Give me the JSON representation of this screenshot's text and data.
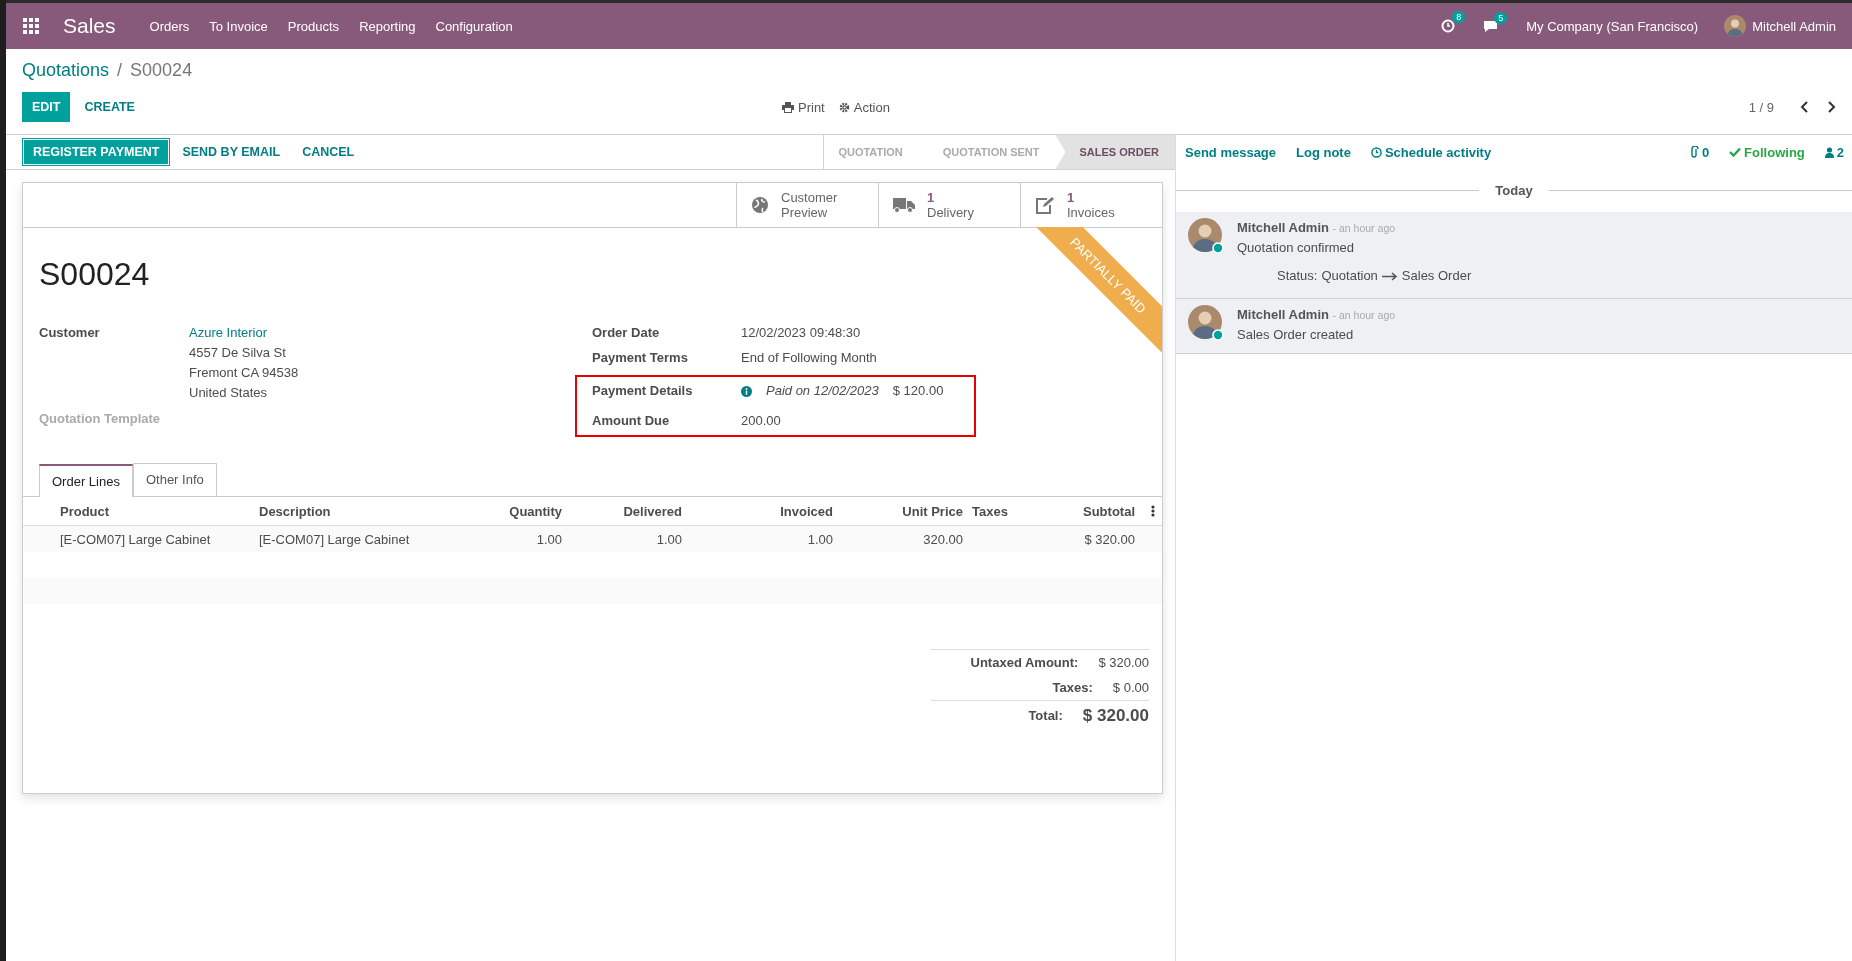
{
  "navbar": {
    "app": "Sales",
    "menu": [
      "Orders",
      "To Invoice",
      "Products",
      "Reporting",
      "Configuration"
    ],
    "activity_count": "8",
    "message_count": "5",
    "company": "My Company (San Francisco)",
    "user": "Mitchell Admin"
  },
  "breadcrumb": {
    "parent": "Quotations",
    "separator": "/",
    "current": "S00024"
  },
  "control_panel": {
    "edit": "EDIT",
    "create": "CREATE",
    "print": "Print",
    "action": "Action",
    "pager": "1 / 9"
  },
  "form_buttons": [
    {
      "label": "REGISTER PAYMENT",
      "primary": true
    },
    {
      "label": "SEND BY EMAIL",
      "primary": false
    },
    {
      "label": "CANCEL",
      "primary": false
    }
  ],
  "stages": [
    {
      "label": "QUOTATION",
      "selected": false
    },
    {
      "label": "QUOTATION SENT",
      "selected": false
    },
    {
      "label": "SALES ORDER",
      "selected": true
    }
  ],
  "smart_buttons": [
    {
      "kind": "globe",
      "label": "Customer Preview"
    },
    {
      "kind": "truck",
      "count": "1",
      "label": "Delivery"
    },
    {
      "kind": "edit",
      "count": "1",
      "label": "Invoices"
    }
  ],
  "ribbon": "PARTIALLY PAID",
  "title": "S00024",
  "customer": {
    "label": "Customer",
    "name": "Azure Interior",
    "address": [
      "4557 De Silva St",
      "Fremont CA 94538",
      "United States"
    ]
  },
  "quotation_template": "Quotation Template",
  "right_fields": [
    {
      "label": "Order Date",
      "value": "12/02/2023 09:48:30"
    },
    {
      "label": "Payment Terms",
      "value": "End of Following Month"
    }
  ],
  "highlighted": {
    "payment_details": {
      "label": "Payment Details",
      "date": "Paid on 12/02/2023",
      "amount": "$ 120.00"
    },
    "amount_due": {
      "label": "Amount Due",
      "value": "200.00"
    }
  },
  "tabs": [
    {
      "label": "Order Lines",
      "selected": true
    },
    {
      "label": "Other Info",
      "selected": false
    }
  ],
  "table": {
    "columns": [
      "Product",
      "Description",
      "Quantity",
      "Delivered",
      "Invoiced",
      "Unit Price",
      "Taxes",
      "Subtotal"
    ],
    "rows": [
      [
        "[E-COM07] Large Cabinet",
        "[E-COM07] Large Cabinet",
        "1.00",
        "1.00",
        "1.00",
        "320.00",
        null,
        "$ 320.00"
      ]
    ]
  },
  "totals": [
    {
      "kind": "line",
      "label": "Untaxed Amount:",
      "value": "$ 320.00"
    },
    {
      "kind": "line",
      "label": "Taxes:",
      "value": "$ 0.00"
    },
    {
      "kind": "total",
      "label": "Total:",
      "value": "$ 320.00"
    }
  ],
  "chatter": {
    "send": "Send message",
    "log": "Log note",
    "schedule": "Schedule activity",
    "attachments": "0",
    "following": "Following",
    "followers": "2",
    "separator": "Today",
    "messages": [
      {
        "author": "Mitchell Admin",
        "time": "- an hour ago",
        "body": "Quotation confirmed",
        "changes": [
          {
            "field": "Status:",
            "old": "Quotation",
            "new": "Sales Order"
          }
        ]
      },
      {
        "author": "Mitchell Admin",
        "time": "- an hour ago",
        "body": "Sales Order created"
      }
    ]
  }
}
